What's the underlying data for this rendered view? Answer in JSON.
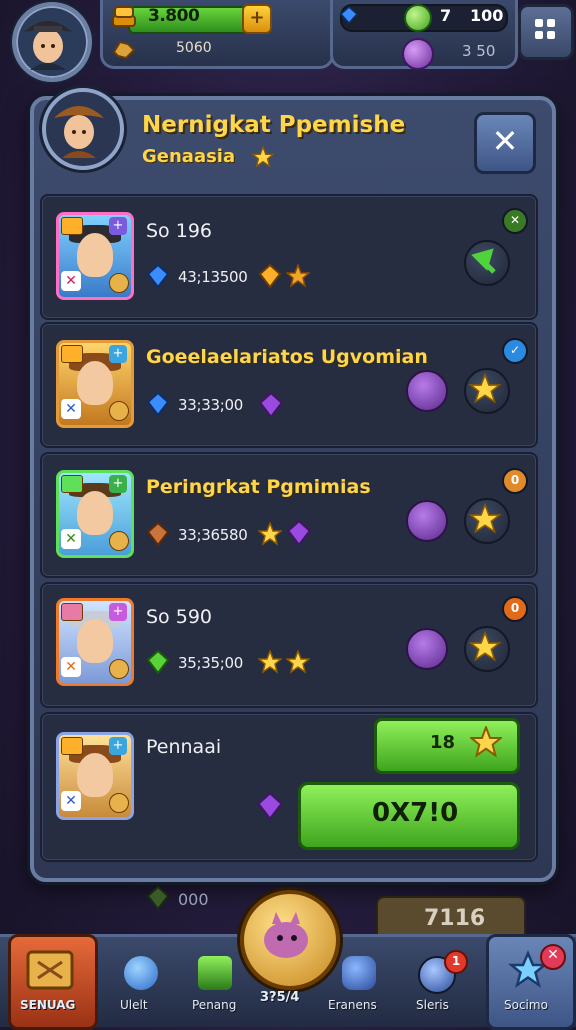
{
  "top": {
    "gold_value": "3.800",
    "gold_plus": "+",
    "sub_value": "5060",
    "stat_a": "7",
    "stat_b": "100",
    "stat_c": "3 50"
  },
  "dialog": {
    "title": "Nernigkat Ppemishe",
    "subtitle": "Genaasia",
    "close_label": "✕",
    "rows": [
      {
        "name": "So 196",
        "value": "43;13500",
        "tag": "✕"
      },
      {
        "name": "Goeelaelariatos Ugvomian",
        "value": "33;33;00",
        "tag": "✓"
      },
      {
        "name": "Peringrkat Pgmimias",
        "value": "33;36580",
        "tag": "0"
      },
      {
        "name": "So 590",
        "value": "35;35;00",
        "tag": "0"
      },
      {
        "name": "Pennaai",
        "value": ""
      }
    ],
    "small_button_value": "18",
    "big_button_label": "0X7!0"
  },
  "under": {
    "value": "000",
    "num": "7116"
  },
  "nav": {
    "left_label": "SENUAG",
    "items": [
      "Ulelt",
      "Penang",
      "3?5/4",
      "Eranens",
      "Sleris"
    ],
    "right_label": "Socimo",
    "badge": "1"
  }
}
